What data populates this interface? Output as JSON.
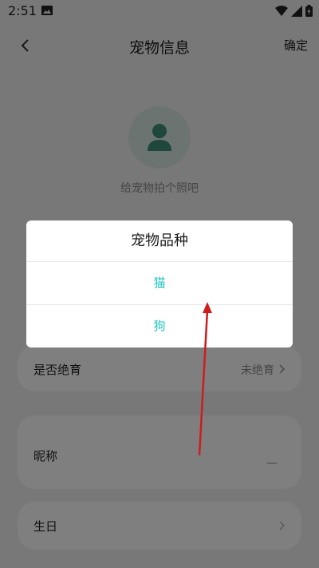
{
  "status_bar": {
    "time": "2:51"
  },
  "nav": {
    "title": "宠物信息",
    "confirm_label": "确定"
  },
  "avatar": {
    "hint": "给宠物拍个照吧"
  },
  "form": {
    "neutered": {
      "label": "是否绝育",
      "value": "未绝育"
    },
    "nickname": {
      "label": "昵称",
      "value": "—"
    },
    "birthday": {
      "label": "生日"
    }
  },
  "dialog": {
    "title": "宠物品种",
    "options": [
      "猫",
      "狗"
    ]
  },
  "colors": {
    "accent": "#19c2c2",
    "annotation": "#cc1e1e"
  }
}
